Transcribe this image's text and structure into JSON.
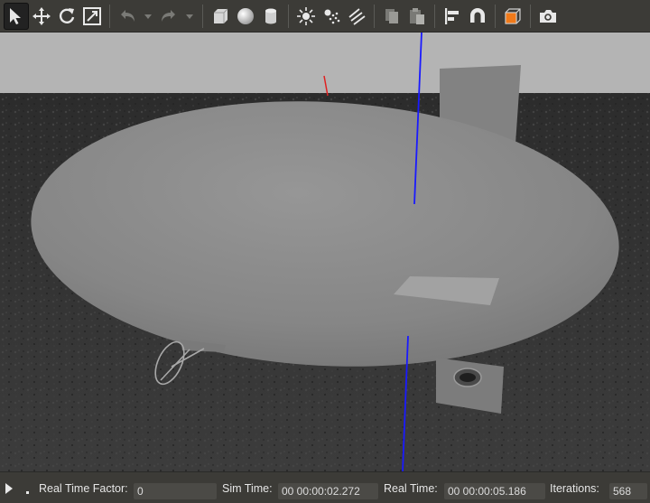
{
  "toolbar": {
    "buttons": [
      {
        "icon": "select-arrow-icon",
        "active": true
      },
      {
        "icon": "translate-icon"
      },
      {
        "icon": "rotate-icon"
      },
      {
        "icon": "scale-icon"
      },
      {
        "icon": "undo-icon"
      },
      {
        "icon": "undo-dropdown-icon"
      },
      {
        "icon": "redo-icon"
      },
      {
        "icon": "redo-dropdown-icon"
      },
      {
        "icon": "box-shape-icon"
      },
      {
        "icon": "sphere-shape-icon"
      },
      {
        "icon": "cylinder-shape-icon"
      },
      {
        "icon": "point-light-icon"
      },
      {
        "icon": "spot-light-icon"
      },
      {
        "icon": "directional-light-icon"
      },
      {
        "icon": "copy-icon"
      },
      {
        "icon": "paste-icon"
      },
      {
        "icon": "align-icon"
      },
      {
        "icon": "snap-magnet-icon"
      },
      {
        "icon": "view-angle-cube-icon"
      },
      {
        "icon": "screenshot-camera-icon"
      }
    ],
    "accent_color": "#f07a1a"
  },
  "viewport": {
    "sky_color": "#b4b4b4",
    "ground_color": "#2f2f2f",
    "model_color": "#8a8a8a",
    "axis_z_color": "#1a1aff",
    "axis_x_color": "#e02020"
  },
  "statusbar": {
    "real_time_factor_label": "Real Time Factor:",
    "real_time_factor_value": "0",
    "sim_time_label": "Sim Time:",
    "sim_time_value": "00 00:00:02.272",
    "real_time_label": "Real Time:",
    "real_time_value": "00 00:00:05.186",
    "iterations_label": "Iterations:",
    "iterations_value": "568"
  }
}
